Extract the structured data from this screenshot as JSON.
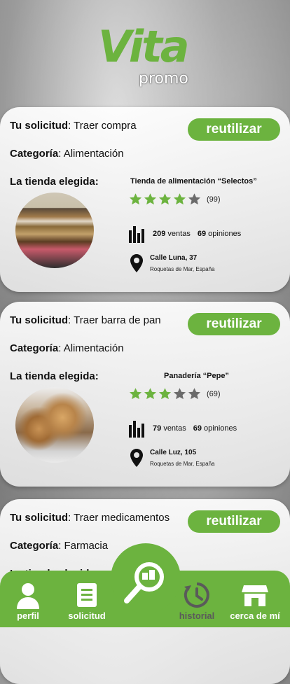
{
  "logo": {
    "brand": "Vita",
    "sub": "promo"
  },
  "labels": {
    "request": "Tu solicitud",
    "category": "Categoría",
    "chosen_store": "La tienda elegida:",
    "reuse": "reutilizar",
    "sales": "ventas",
    "opinions": "opiniones"
  },
  "cards": [
    {
      "request_value": ": Traer compra",
      "category_value": ": Alimentación",
      "store": "Tienda de alimentación “Selectos”",
      "rating": 4,
      "reviews": "(99)",
      "sales": "209",
      "opinions": "69",
      "street": "Calle Luna, 37",
      "city": "Roquetas de Mar, España"
    },
    {
      "request_value": ": Traer barra de pan",
      "category_value": ": Alimentación",
      "store": "Panadería “Pepe”",
      "rating": 3,
      "reviews": "(69)",
      "sales": "79",
      "opinions": "69",
      "street": "Calle Luz, 105",
      "city": "Roquetas de Mar, España"
    },
    {
      "request_value": ": Traer medicamentos",
      "category_value": ": Farmacia"
    }
  ],
  "nav": {
    "profile": "perfil",
    "request": "solicitud",
    "history": "historial",
    "nearby": "cerca de mí"
  },
  "colors": {
    "accent": "#6cb33f",
    "star_off": "#6b6b6b"
  }
}
